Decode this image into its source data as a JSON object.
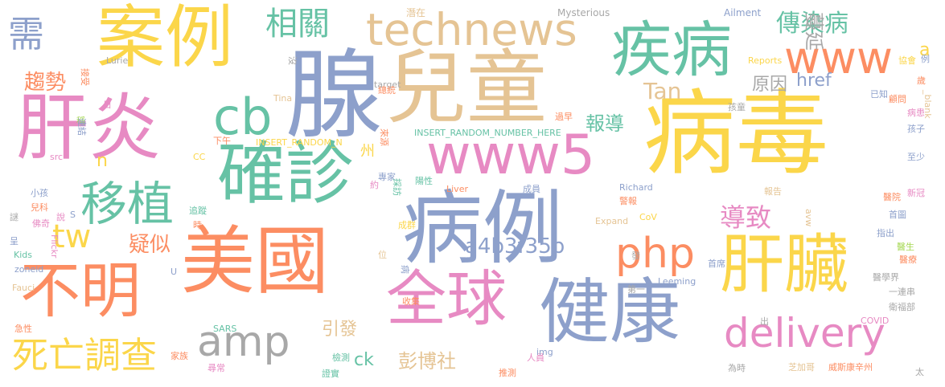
{
  "palette": {
    "yellow": "#fbd64a",
    "blue": "#8da0cb",
    "orange": "#fc8d62",
    "pink": "#e78ac3",
    "tan": "#e5c494",
    "green": "#66c2a5",
    "lime": "#a6d854",
    "gray": "#a8a8a8"
  },
  "words": [
    {
      "text": "病毒",
      "color": "yellow"
    },
    {
      "text": "案例",
      "color": "yellow"
    },
    {
      "text": "腺",
      "color": "blue"
    },
    {
      "text": "兒童",
      "color": "tan"
    },
    {
      "text": "肝炎",
      "color": "pink"
    },
    {
      "text": "美國",
      "color": "orange"
    },
    {
      "text": "病例",
      "color": "blue"
    },
    {
      "text": "確診",
      "color": "green"
    },
    {
      "text": "健康",
      "color": "blue"
    },
    {
      "text": "肝臟",
      "color": "yellow"
    },
    {
      "text": "疾病",
      "color": "green"
    },
    {
      "text": "technews",
      "color": "tan"
    },
    {
      "text": "www5",
      "color": "pink"
    },
    {
      "text": "不明",
      "color": "orange"
    },
    {
      "text": "全球",
      "color": "pink"
    },
    {
      "text": "需",
      "color": "blue"
    },
    {
      "text": "www",
      "color": "orange"
    },
    {
      "text": "cb",
      "color": "green"
    },
    {
      "text": "移植",
      "color": "green"
    },
    {
      "text": "amp",
      "color": "gray"
    },
    {
      "text": "php",
      "color": "orange"
    },
    {
      "text": "delivery",
      "color": "pink"
    },
    {
      "text": "死亡調查",
      "color": "yellow"
    },
    {
      "text": "tw",
      "color": "yellow"
    },
    {
      "text": "相關",
      "color": "green"
    },
    {
      "text": "傳染病",
      "color": "green"
    },
    {
      "text": "導致",
      "color": "pink"
    },
    {
      "text": "a4b3f35b",
      "color": "blue"
    },
    {
      "text": "Tan",
      "color": "tan"
    },
    {
      "text": "趨勢",
      "color": "orange"
    },
    {
      "text": "蔓延",
      "color": "gray"
    },
    {
      "text": "報導",
      "color": "green"
    },
    {
      "text": "原因",
      "color": "gray"
    },
    {
      "text": "href",
      "color": "blue"
    },
    {
      "text": "疑似",
      "color": "orange"
    },
    {
      "text": "引發",
      "color": "tan"
    },
    {
      "text": "彭博社",
      "color": "tan"
    },
    {
      "text": "ck",
      "color": "green"
    },
    {
      "text": "州",
      "color": "yellow"
    },
    {
      "text": "n",
      "color": "yellow"
    },
    {
      "text": "a",
      "color": "yellow"
    },
    {
      "text": "潛在",
      "color": "tan"
    },
    {
      "text": "Mysterious",
      "color": "gray"
    },
    {
      "text": "Ailment",
      "color": "blue"
    },
    {
      "text": "協會",
      "color": "yellow"
    },
    {
      "text": "例",
      "color": "blue"
    },
    {
      "text": "Reports",
      "color": "yellow"
    },
    {
      "text": "歲",
      "color": "orange"
    },
    {
      "text": "顧問",
      "color": "orange"
    },
    {
      "text": "_blank",
      "color": "tan"
    },
    {
      "text": "孩童",
      "color": "gray"
    },
    {
      "text": "已知",
      "color": "blue"
    },
    {
      "text": "病患",
      "color": "pink"
    },
    {
      "text": "孩子",
      "color": "blue"
    },
    {
      "text": "至少",
      "color": "blue"
    },
    {
      "text": "新冠",
      "color": "pink"
    },
    {
      "text": "醫院",
      "color": "orange"
    },
    {
      "text": "首圖",
      "color": "blue"
    },
    {
      "text": "指出",
      "color": "blue"
    },
    {
      "text": "醫生",
      "color": "lime"
    },
    {
      "text": "醫療",
      "color": "orange"
    },
    {
      "text": "醫學界",
      "color": "gray"
    },
    {
      "text": "一連串",
      "color": "gray"
    },
    {
      "text": "衛福部",
      "color": "gray"
    },
    {
      "text": "COVID",
      "color": "pink"
    },
    {
      "text": "威斯康辛州",
      "color": "orange"
    },
    {
      "text": "太",
      "color": "gray"
    },
    {
      "text": "Lurie",
      "color": "gray"
    },
    {
      "text": "接受",
      "color": "orange"
    },
    {
      "text": "沒",
      "color": "gray"
    },
    {
      "text": "target",
      "color": "gray"
    },
    {
      "text": "Tina",
      "color": "tan"
    },
    {
      "text": "總統",
      "color": "orange"
    },
    {
      "text": "下午",
      "color": "orange"
    },
    {
      "text": "INSERT_RANDOM_N",
      "color": "yellow"
    },
    {
      "text": "INSERT_RANDOM_NUMBER_HERE",
      "color": "green"
    },
    {
      "text": "來源",
      "color": "orange"
    },
    {
      "text": "約",
      "color": "pink"
    },
    {
      "text": "專家",
      "color": "blue"
    },
    {
      "text": "陽性",
      "color": "green"
    },
    {
      "text": "採訪",
      "color": "green"
    },
    {
      "text": "Liver",
      "color": "orange"
    },
    {
      "text": "成員",
      "color": "blue"
    },
    {
      "text": "Richard",
      "color": "blue"
    },
    {
      "text": "警報",
      "color": "orange"
    },
    {
      "text": "報告",
      "color": "tan"
    },
    {
      "text": "avw",
      "color": "tan"
    },
    {
      "text": "過早",
      "color": "orange"
    },
    {
      "text": "日",
      "color": "pink"
    },
    {
      "text": "稱",
      "color": "lime"
    },
    {
      "text": "連結",
      "color": "blue"
    },
    {
      "text": "src",
      "color": "pink"
    },
    {
      "text": "CC",
      "color": "yellow"
    },
    {
      "text": "小孩",
      "color": "blue"
    },
    {
      "text": "兒科",
      "color": "orange"
    },
    {
      "text": "謎",
      "color": "gray"
    },
    {
      "text": "佛奇",
      "color": "pink"
    },
    {
      "text": "追蹤",
      "color": "green"
    },
    {
      "text": "說",
      "color": "pink"
    },
    {
      "text": "S",
      "color": "blue"
    },
    {
      "text": "時",
      "color": "orange"
    },
    {
      "text": "呈",
      "color": "blue"
    },
    {
      "text": "Kids",
      "color": "green"
    },
    {
      "text": "Flickr",
      "color": "pink"
    },
    {
      "text": "zoneid",
      "color": "blue"
    },
    {
      "text": "U",
      "color": "blue"
    },
    {
      "text": "Fauci",
      "color": "tan"
    },
    {
      "text": "急性",
      "color": "orange"
    },
    {
      "text": "家族",
      "color": "orange"
    },
    {
      "text": "SARS",
      "color": "green"
    },
    {
      "text": "尋常",
      "color": "pink"
    },
    {
      "text": "檢測",
      "color": "green"
    },
    {
      "text": "證實",
      "color": "green"
    },
    {
      "text": "推測",
      "color": "orange"
    },
    {
      "text": "人員",
      "color": "pink"
    },
    {
      "text": "img",
      "color": "blue"
    },
    {
      "text": "收集",
      "color": "orange"
    },
    {
      "text": "位",
      "color": "tan"
    },
    {
      "text": "病",
      "color": "blue"
    },
    {
      "text": "成群",
      "color": "yellow"
    },
    {
      "text": "Expand",
      "color": "tan"
    },
    {
      "text": "CoV",
      "color": "yellow"
    },
    {
      "text": "發",
      "color": "gray"
    },
    {
      "text": "第一",
      "color": "gray"
    },
    {
      "text": "Leeming",
      "color": "blue"
    },
    {
      "text": "首席",
      "color": "blue"
    },
    {
      "text": "出",
      "color": "gray"
    },
    {
      "text": "為時",
      "color": "gray"
    },
    {
      "text": "芝加哥",
      "color": "tan"
    }
  ]
}
